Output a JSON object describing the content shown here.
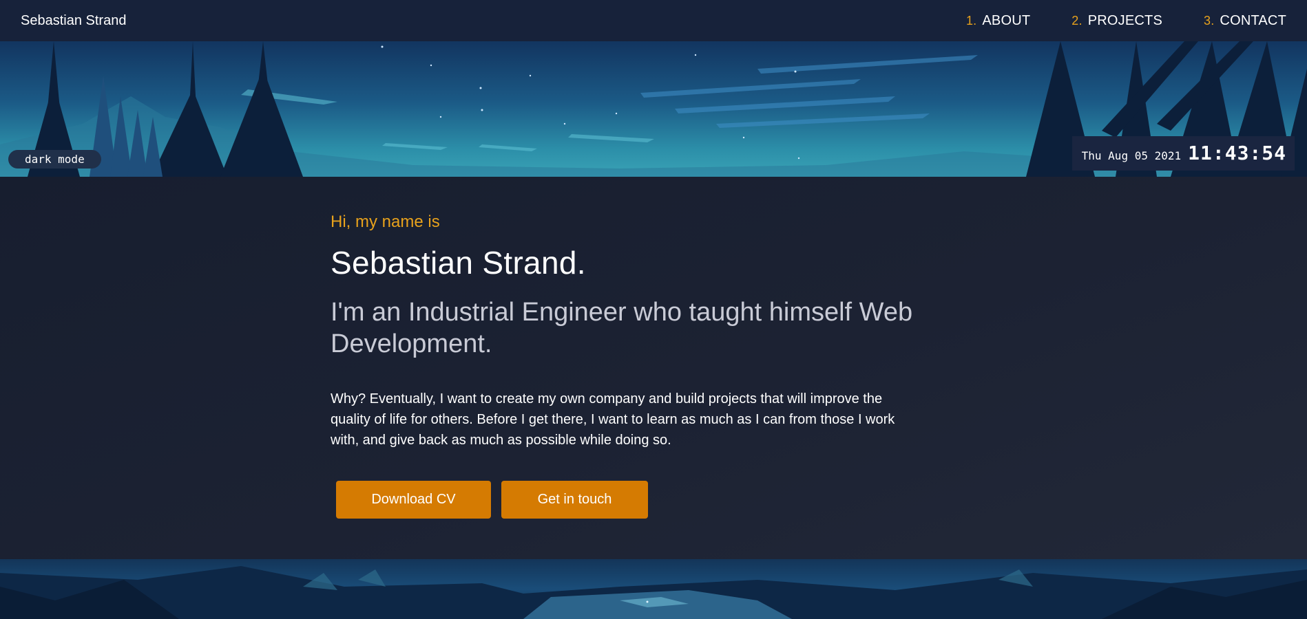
{
  "nav": {
    "brand": "Sebastian Strand",
    "links": [
      {
        "num": "1.",
        "label": "ABOUT"
      },
      {
        "num": "2.",
        "label": "PROJECTS"
      },
      {
        "num": "3.",
        "label": "CONTACT"
      }
    ]
  },
  "hero": {
    "dark_mode_label": "dark mode",
    "clock": {
      "date": "Thu Aug 05 2021",
      "time": "11:43:54"
    }
  },
  "intro": {
    "greeting": "Hi, my name is",
    "name": "Sebastian Strand.",
    "tagline": "I'm an Industrial Engineer who taught himself Web Development.",
    "bio": "Why? Eventually, I want to create my own company and build projects that will improve the quality of life for others. Before I get there, I want to learn as much as I can from those I work with, and give back as much as possible while doing so.",
    "buttons": {
      "download_cv": "Download CV",
      "get_in_touch": "Get in touch"
    }
  },
  "colors": {
    "accent": "#e8a21c",
    "button": "#d57b02",
    "navbar": "#17223a",
    "main_bg": "#1c2233"
  }
}
